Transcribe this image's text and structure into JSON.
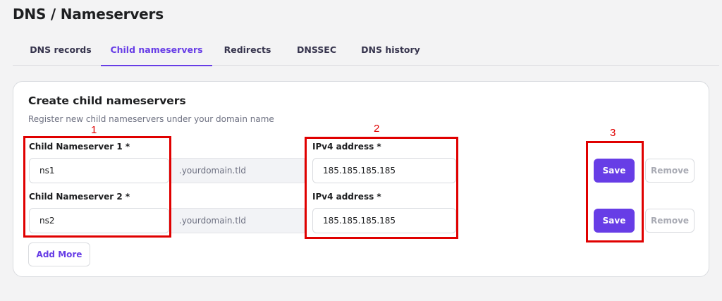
{
  "page": {
    "title": "DNS / Nameservers"
  },
  "tabs": [
    {
      "label": "DNS records",
      "active": false
    },
    {
      "label": "Child nameservers",
      "active": true
    },
    {
      "label": "Redirects",
      "active": false
    },
    {
      "label": "DNSSEC",
      "active": false
    },
    {
      "label": "DNS history",
      "active": false
    }
  ],
  "card": {
    "title": "Create child nameservers",
    "subtitle": "Register new child nameservers under your domain name"
  },
  "rows": [
    {
      "ns_label": "Child Nameserver 1 *",
      "ns_value": "ns1",
      "suffix": ".yourdomain.tld",
      "ip_label": "IPv4 address *",
      "ip_value": "185.185.185.185",
      "save_label": "Save",
      "remove_label": "Remove"
    },
    {
      "ns_label": "Child Nameserver 2 *",
      "ns_value": "ns2",
      "suffix": ".yourdomain.tld",
      "ip_label": "IPv4 address *",
      "ip_value": "185.185.185.185",
      "save_label": "Save",
      "remove_label": "Remove"
    }
  ],
  "add_more_label": "Add More",
  "annotations": [
    "1",
    "2",
    "3"
  ],
  "colors": {
    "accent": "#673de6",
    "annotation": "#e00000"
  }
}
